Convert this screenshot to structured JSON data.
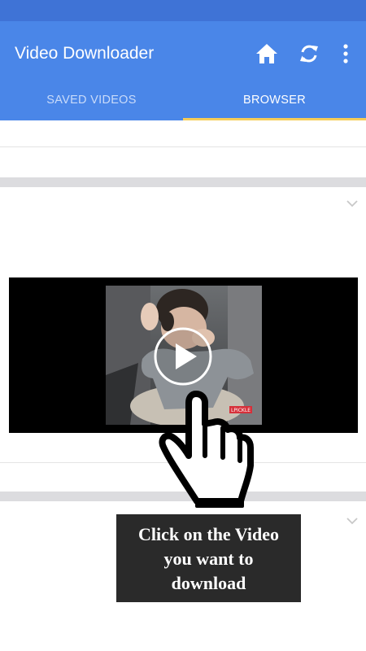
{
  "app_bar": {
    "title": "Video Downloader",
    "icons": [
      "home-icon",
      "sync-icon",
      "more-vert-icon"
    ],
    "colors": {
      "primary": "#4a86e8",
      "status_bar": "#3f73d6",
      "tab_indicator": "#f6cd57"
    }
  },
  "tabs": [
    {
      "label": "SAVED VIDEOS",
      "selected": false
    },
    {
      "label": "BROWSER",
      "selected": true
    }
  ],
  "video": {
    "badge": "LPICKLE",
    "controls": [
      "play-icon"
    ]
  },
  "callout": {
    "lines": [
      "Click on the Video",
      "you want to",
      "download"
    ]
  }
}
